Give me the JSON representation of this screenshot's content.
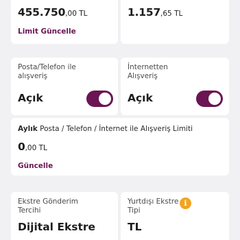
{
  "top_left": {
    "amount_int": "455.750",
    "amount_dec": ",00 TL",
    "action": "Limit Güncelle"
  },
  "top_right": {
    "amount_int": "1.157",
    "amount_dec": ",65 TL"
  },
  "posta_card": {
    "label_line1": "Posta/Telefon ile",
    "label_line2": "alışveriş",
    "status": "Açık",
    "toggle_on": true
  },
  "internet_card": {
    "label_line1": "İnternetten",
    "label_line2": "Alışveriş",
    "status": "Açık",
    "toggle_on": true
  },
  "monthly_card": {
    "label_bold": "Aylık",
    "label_rest": " Posta / Telefon / İnternet ile Alışveriş Limiti",
    "amount_int": "0",
    "amount_dec": ",00 TL",
    "action": "Güncelle"
  },
  "statement_card": {
    "label_line1": "Ekstre Gönderim",
    "label_line2": "Tercihi",
    "value": "Dijital Ekstre"
  },
  "foreign_card": {
    "label_line1": "Yurtdışı Ekstre",
    "label_line2": "Tipi",
    "value": "TL",
    "info_icon": "info-icon"
  },
  "colors": {
    "brand": "#6b1554",
    "info": "#f2a41f",
    "background": "#f1f1f3"
  }
}
